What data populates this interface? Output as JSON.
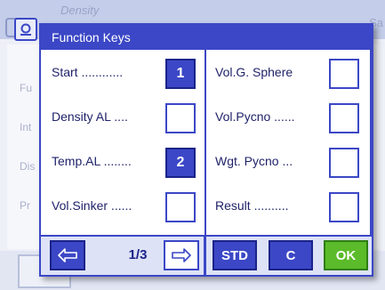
{
  "background": {
    "title": "Density",
    "title_right": "Sa",
    "labels": [
      "Fu",
      "Int",
      "Dis",
      "Pr"
    ]
  },
  "dialog": {
    "title": "Function Keys",
    "left_keys": [
      {
        "label": "Start ............",
        "number": "1"
      },
      {
        "label": "Density  AL ....",
        "number": ""
      },
      {
        "label": "Temp.AL ........",
        "number": "2"
      },
      {
        "label": "Vol.Sinker ......",
        "number": ""
      }
    ],
    "right_keys": [
      {
        "label": "Vol.G. Sphere",
        "number": ""
      },
      {
        "label": "Vol.Pycno ......",
        "number": ""
      },
      {
        "label": "Wgt. Pycno  ...",
        "number": ""
      },
      {
        "label": "Result  ..........",
        "number": ""
      }
    ],
    "footer": {
      "page": "1/3",
      "std_label": "STD",
      "c_label": "C",
      "ok_label": "OK"
    }
  },
  "colors": {
    "accent": "#3b47c6",
    "ok": "#5bbb2a"
  }
}
